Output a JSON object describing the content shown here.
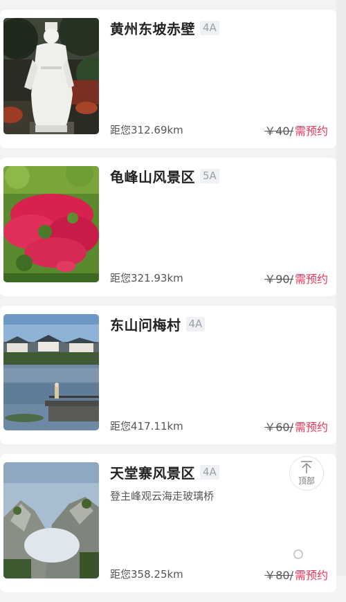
{
  "attractions": [
    {
      "name": "黄州东坡赤壁",
      "level": "4A",
      "subtitle": "",
      "distance": "距您312.69km",
      "price": "￥40/",
      "booking": "需预约",
      "image": "white-statue-photo"
    },
    {
      "name": "龟峰山风景区",
      "level": "5A",
      "subtitle": "",
      "distance": "距您321.93km",
      "price": "￥90/",
      "booking": "需预约",
      "image": "azalea-hills-photo"
    },
    {
      "name": "东山问梅村",
      "level": "4A",
      "subtitle": "",
      "distance": "距您417.11km",
      "price": "￥60/",
      "booking": "需预约",
      "image": "lake-village-photo"
    },
    {
      "name": "天堂寨风景区",
      "level": "4A",
      "subtitle": "登主峰观云海走玻璃桥",
      "distance": "距您358.25km",
      "price": "￥80/",
      "booking": "需预约",
      "image": "misty-mountain-photo"
    }
  ],
  "back_to_top": {
    "label": "顶部",
    "icon": "arrow-up-icon"
  },
  "colors": {
    "accent": "#e8345a",
    "level_bg": "#f0f1f5",
    "level_text": "#9aa0a6"
  }
}
